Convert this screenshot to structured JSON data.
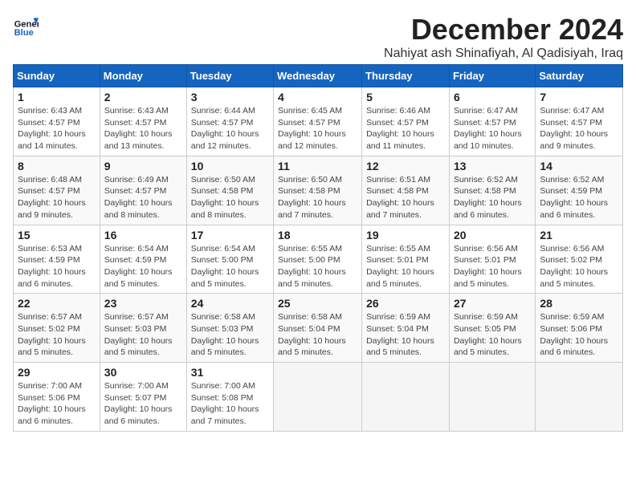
{
  "header": {
    "logo_general": "General",
    "logo_blue": "Blue",
    "month_title": "December 2024",
    "subtitle": "Nahiyat ash Shinafiyah, Al Qadisiyah, Iraq"
  },
  "weekdays": [
    "Sunday",
    "Monday",
    "Tuesday",
    "Wednesday",
    "Thursday",
    "Friday",
    "Saturday"
  ],
  "weeks": [
    [
      {
        "day": "1",
        "sunrise": "6:43 AM",
        "sunset": "4:57 PM",
        "daylight": "10 hours and 14 minutes."
      },
      {
        "day": "2",
        "sunrise": "6:43 AM",
        "sunset": "4:57 PM",
        "daylight": "10 hours and 13 minutes."
      },
      {
        "day": "3",
        "sunrise": "6:44 AM",
        "sunset": "4:57 PM",
        "daylight": "10 hours and 12 minutes."
      },
      {
        "day": "4",
        "sunrise": "6:45 AM",
        "sunset": "4:57 PM",
        "daylight": "10 hours and 12 minutes."
      },
      {
        "day": "5",
        "sunrise": "6:46 AM",
        "sunset": "4:57 PM",
        "daylight": "10 hours and 11 minutes."
      },
      {
        "day": "6",
        "sunrise": "6:47 AM",
        "sunset": "4:57 PM",
        "daylight": "10 hours and 10 minutes."
      },
      {
        "day": "7",
        "sunrise": "6:47 AM",
        "sunset": "4:57 PM",
        "daylight": "10 hours and 9 minutes."
      }
    ],
    [
      {
        "day": "8",
        "sunrise": "6:48 AM",
        "sunset": "4:57 PM",
        "daylight": "10 hours and 9 minutes."
      },
      {
        "day": "9",
        "sunrise": "6:49 AM",
        "sunset": "4:57 PM",
        "daylight": "10 hours and 8 minutes."
      },
      {
        "day": "10",
        "sunrise": "6:50 AM",
        "sunset": "4:58 PM",
        "daylight": "10 hours and 8 minutes."
      },
      {
        "day": "11",
        "sunrise": "6:50 AM",
        "sunset": "4:58 PM",
        "daylight": "10 hours and 7 minutes."
      },
      {
        "day": "12",
        "sunrise": "6:51 AM",
        "sunset": "4:58 PM",
        "daylight": "10 hours and 7 minutes."
      },
      {
        "day": "13",
        "sunrise": "6:52 AM",
        "sunset": "4:58 PM",
        "daylight": "10 hours and 6 minutes."
      },
      {
        "day": "14",
        "sunrise": "6:52 AM",
        "sunset": "4:59 PM",
        "daylight": "10 hours and 6 minutes."
      }
    ],
    [
      {
        "day": "15",
        "sunrise": "6:53 AM",
        "sunset": "4:59 PM",
        "daylight": "10 hours and 6 minutes."
      },
      {
        "day": "16",
        "sunrise": "6:54 AM",
        "sunset": "4:59 PM",
        "daylight": "10 hours and 5 minutes."
      },
      {
        "day": "17",
        "sunrise": "6:54 AM",
        "sunset": "5:00 PM",
        "daylight": "10 hours and 5 minutes."
      },
      {
        "day": "18",
        "sunrise": "6:55 AM",
        "sunset": "5:00 PM",
        "daylight": "10 hours and 5 minutes."
      },
      {
        "day": "19",
        "sunrise": "6:55 AM",
        "sunset": "5:01 PM",
        "daylight": "10 hours and 5 minutes."
      },
      {
        "day": "20",
        "sunrise": "6:56 AM",
        "sunset": "5:01 PM",
        "daylight": "10 hours and 5 minutes."
      },
      {
        "day": "21",
        "sunrise": "6:56 AM",
        "sunset": "5:02 PM",
        "daylight": "10 hours and 5 minutes."
      }
    ],
    [
      {
        "day": "22",
        "sunrise": "6:57 AM",
        "sunset": "5:02 PM",
        "daylight": "10 hours and 5 minutes."
      },
      {
        "day": "23",
        "sunrise": "6:57 AM",
        "sunset": "5:03 PM",
        "daylight": "10 hours and 5 minutes."
      },
      {
        "day": "24",
        "sunrise": "6:58 AM",
        "sunset": "5:03 PM",
        "daylight": "10 hours and 5 minutes."
      },
      {
        "day": "25",
        "sunrise": "6:58 AM",
        "sunset": "5:04 PM",
        "daylight": "10 hours and 5 minutes."
      },
      {
        "day": "26",
        "sunrise": "6:59 AM",
        "sunset": "5:04 PM",
        "daylight": "10 hours and 5 minutes."
      },
      {
        "day": "27",
        "sunrise": "6:59 AM",
        "sunset": "5:05 PM",
        "daylight": "10 hours and 5 minutes."
      },
      {
        "day": "28",
        "sunrise": "6:59 AM",
        "sunset": "5:06 PM",
        "daylight": "10 hours and 6 minutes."
      }
    ],
    [
      {
        "day": "29",
        "sunrise": "7:00 AM",
        "sunset": "5:06 PM",
        "daylight": "10 hours and 6 minutes."
      },
      {
        "day": "30",
        "sunrise": "7:00 AM",
        "sunset": "5:07 PM",
        "daylight": "10 hours and 6 minutes."
      },
      {
        "day": "31",
        "sunrise": "7:00 AM",
        "sunset": "5:08 PM",
        "daylight": "10 hours and 7 minutes."
      },
      null,
      null,
      null,
      null
    ]
  ]
}
